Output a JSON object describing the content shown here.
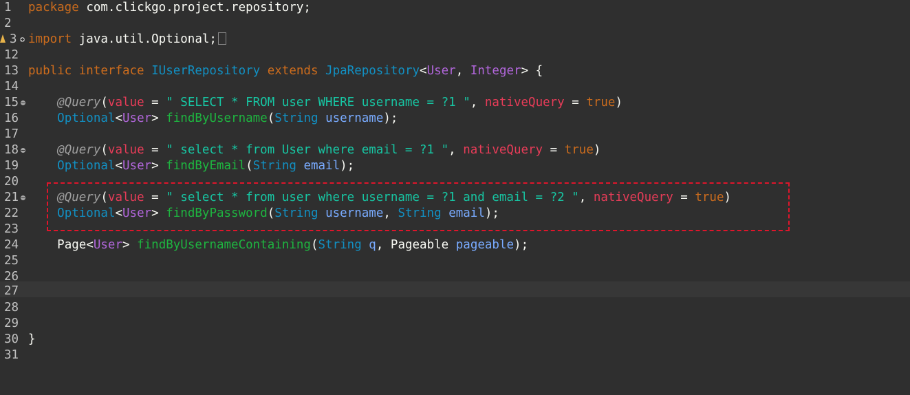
{
  "editor": {
    "language": "java",
    "file_content": {
      "package_kw": "package",
      "package_name": "com.clickgo.project.repository",
      "import_kw": "import",
      "import_name": "java.util.Optional",
      "public_kw": "public",
      "interface_kw": "interface",
      "interface_name": "IUserRepository",
      "extends_kw": "extends",
      "super_type": "JpaRepository",
      "generic_user": "User",
      "generic_integer": "Integer"
    },
    "queries": [
      {
        "annotation": "@Query",
        "value_attr": "value",
        "sql": "\" SELECT * FROM user WHERE username = ?1 \"",
        "native_attr": "nativeQuery",
        "native_value": "true",
        "return_type": "Optional",
        "generic": "User",
        "method": "findByUsername",
        "params": [
          {
            "type": "String",
            "name": "username"
          }
        ]
      },
      {
        "annotation": "@Query",
        "value_attr": "value",
        "sql": "\" select * from User where email = ?1 \"",
        "native_attr": "nativeQuery",
        "native_value": "true",
        "return_type": "Optional",
        "generic": "User",
        "method": "findByEmail",
        "params": [
          {
            "type": "String",
            "name": "email"
          }
        ]
      },
      {
        "annotation": "@Query",
        "value_attr": "value",
        "sql": "\" select * from user where username = ?1 and email = ?2 \"",
        "native_attr": "nativeQuery",
        "native_value": "true",
        "return_type": "Optional",
        "generic": "User",
        "method": "findByPassword",
        "params": [
          {
            "type": "String",
            "name": "username"
          },
          {
            "type": "String",
            "name": "email"
          }
        ]
      }
    ],
    "page_method": {
      "return_type": "Page",
      "generic": "User",
      "method": "findByUsernameContaining",
      "params": [
        {
          "type": "String",
          "name": "q"
        },
        {
          "type": "Pageable",
          "name": "pageable"
        }
      ]
    },
    "line_numbers": [
      "1",
      "2",
      "3",
      "12",
      "13",
      "14",
      "15",
      "16",
      "17",
      "18",
      "19",
      "20",
      "21",
      "22",
      "23",
      "24",
      "25",
      "26",
      "27",
      "28",
      "29",
      "30",
      "31"
    ],
    "highlight_annotation": "dashed-red-box around lines 21-23",
    "colors": {
      "background": "#2f2f2f",
      "highlight_box": "#e0152b",
      "current_line": "#373737"
    }
  }
}
